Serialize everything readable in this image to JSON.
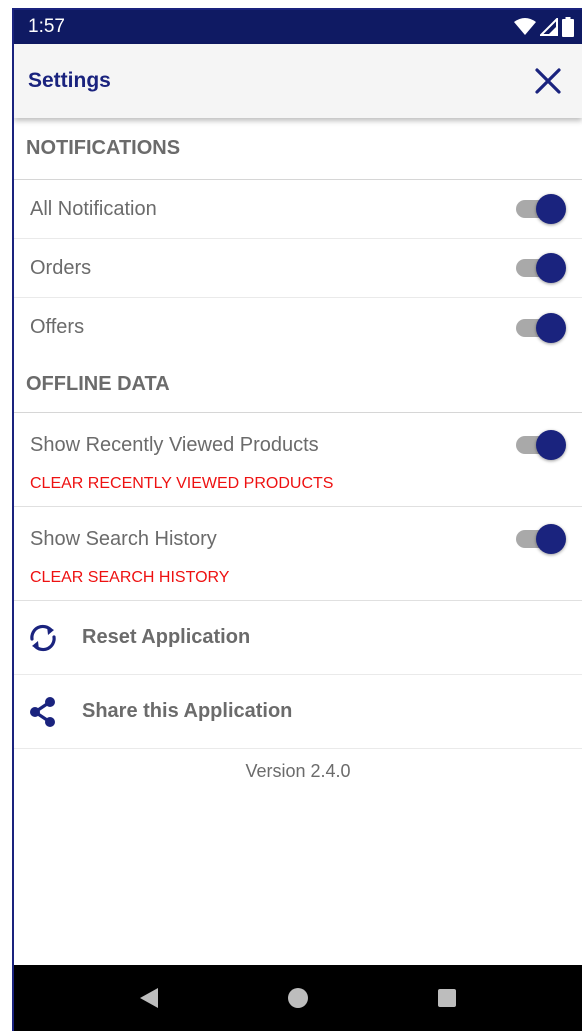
{
  "status_bar": {
    "time": "1:57",
    "icons": [
      "wifi-icon",
      "signal-icon",
      "battery-icon"
    ]
  },
  "app_bar": {
    "title": "Settings",
    "close_icon": "close-icon"
  },
  "sections": {
    "notifications": {
      "header": "NOTIFICATIONS",
      "items": [
        {
          "label": "All Notification",
          "enabled": true
        },
        {
          "label": "Orders",
          "enabled": true
        },
        {
          "label": "Offers",
          "enabled": true
        }
      ]
    },
    "offline_data": {
      "header": "OFFLINE DATA",
      "items": [
        {
          "label": "Show Recently Viewed Products",
          "enabled": true,
          "clear_label": "CLEAR RECENTLY VIEWED PRODUCTS"
        },
        {
          "label": "Show Search History",
          "enabled": true,
          "clear_label": "CLEAR SEARCH HISTORY"
        }
      ]
    }
  },
  "actions": [
    {
      "label": "Reset Application",
      "icon": "reset-icon"
    },
    {
      "label": "Share this Application",
      "icon": "share-icon"
    }
  ],
  "version": "Version 2.4.0",
  "colors": {
    "primary": "#1a237e",
    "status_bar": "#0f1a63",
    "danger": "#ee1111",
    "text_muted": "#6b6b6b"
  },
  "nav_bar": {
    "buttons": [
      "back-icon",
      "home-icon",
      "recents-icon"
    ]
  }
}
